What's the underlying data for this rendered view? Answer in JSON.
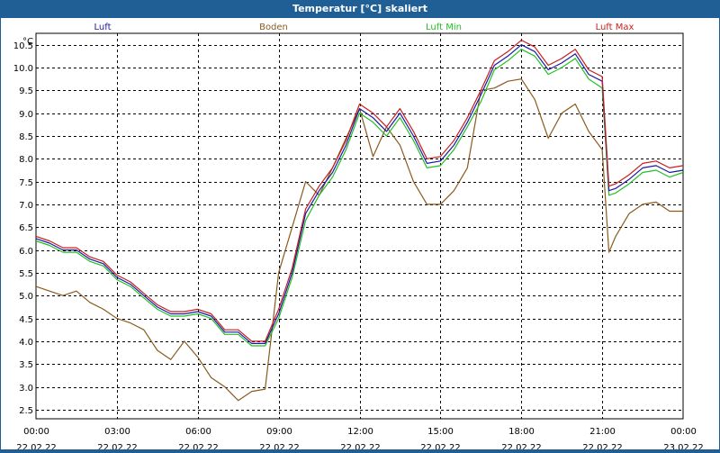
{
  "chart_data": {
    "type": "line",
    "title": "Temperatur [°C] skaliert",
    "ylabel": "°C",
    "ylim": [
      2.3,
      10.75
    ],
    "yticks": [
      2.5,
      3.0,
      3.5,
      4.0,
      4.5,
      5.0,
      5.5,
      6.0,
      6.5,
      7.0,
      7.5,
      8.0,
      8.5,
      9.0,
      9.5,
      10.0,
      10.5
    ],
    "ytick_labels": [
      "2.5",
      "3.0",
      "3.5",
      "4.0",
      "4.5",
      "5.0",
      "5.5",
      "6.0",
      "6.5",
      "7.0",
      "7.5",
      "8.0",
      "8.5",
      "9.0",
      "9.5",
      "10.0",
      "10.5"
    ],
    "x_hours": [
      0,
      3,
      6,
      9,
      12,
      15,
      18,
      21,
      24
    ],
    "xtick_time": [
      "00:00",
      "03:00",
      "06:00",
      "09:00",
      "12:00",
      "15:00",
      "18:00",
      "21:00",
      "00:00"
    ],
    "xtick_date": [
      "22.02.22",
      "22.02.22",
      "22.02.22",
      "22.02.22",
      "22.02.22",
      "22.02.22",
      "22.02.22",
      "22.02.22",
      "23.02.22"
    ],
    "grid": true,
    "legend_position": "top",
    "series": [
      {
        "name": "Luft",
        "color": "#1a1aa6",
        "points": [
          [
            0,
            6.25
          ],
          [
            0.5,
            6.15
          ],
          [
            1,
            6.0
          ],
          [
            1.5,
            6.0
          ],
          [
            2,
            5.8
          ],
          [
            2.5,
            5.7
          ],
          [
            3,
            5.4
          ],
          [
            3.5,
            5.25
          ],
          [
            4,
            5.0
          ],
          [
            4.5,
            4.75
          ],
          [
            5,
            4.6
          ],
          [
            5.5,
            4.6
          ],
          [
            6,
            4.65
          ],
          [
            6.5,
            4.55
          ],
          [
            7,
            4.2
          ],
          [
            7.5,
            4.2
          ],
          [
            8,
            3.95
          ],
          [
            8.5,
            3.95
          ],
          [
            9,
            4.6
          ],
          [
            9.5,
            5.5
          ],
          [
            10,
            6.8
          ],
          [
            10.5,
            7.3
          ],
          [
            11,
            7.7
          ],
          [
            11.5,
            8.3
          ],
          [
            12,
            9.1
          ],
          [
            12.5,
            8.9
          ],
          [
            13,
            8.6
          ],
          [
            13.5,
            9.0
          ],
          [
            14,
            8.5
          ],
          [
            14.5,
            7.9
          ],
          [
            15,
            7.95
          ],
          [
            15.5,
            8.3
          ],
          [
            16,
            8.8
          ],
          [
            16.5,
            9.4
          ],
          [
            17,
            10.05
          ],
          [
            17.5,
            10.25
          ],
          [
            18,
            10.5
          ],
          [
            18.5,
            10.35
          ],
          [
            19,
            9.95
          ],
          [
            19.5,
            10.1
          ],
          [
            20,
            10.3
          ],
          [
            20.5,
            9.85
          ],
          [
            21,
            9.7
          ],
          [
            21.25,
            7.3
          ],
          [
            21.5,
            7.35
          ],
          [
            22,
            7.55
          ],
          [
            22.5,
            7.8
          ],
          [
            23,
            7.85
          ],
          [
            23.5,
            7.7
          ],
          [
            24,
            7.75
          ]
        ]
      },
      {
        "name": "Boden",
        "color": "#8b5a1e",
        "points": [
          [
            0,
            5.2
          ],
          [
            0.5,
            5.1
          ],
          [
            1,
            5.0
          ],
          [
            1.5,
            5.1
          ],
          [
            2,
            4.85
          ],
          [
            2.5,
            4.7
          ],
          [
            3,
            4.5
          ],
          [
            3.5,
            4.4
          ],
          [
            4,
            4.25
          ],
          [
            4.5,
            3.8
          ],
          [
            5,
            3.6
          ],
          [
            5.5,
            4.0
          ],
          [
            6,
            3.65
          ],
          [
            6.5,
            3.2
          ],
          [
            7,
            3.0
          ],
          [
            7.5,
            2.7
          ],
          [
            8,
            2.9
          ],
          [
            8.5,
            2.95
          ],
          [
            9,
            5.5
          ],
          [
            9.5,
            6.5
          ],
          [
            10,
            7.5
          ],
          [
            10.5,
            7.2
          ],
          [
            11,
            7.8
          ],
          [
            11.5,
            8.45
          ],
          [
            12,
            9.1
          ],
          [
            12.5,
            8.05
          ],
          [
            13,
            8.7
          ],
          [
            13.5,
            8.3
          ],
          [
            14,
            7.5
          ],
          [
            14.5,
            7.0
          ],
          [
            15,
            7.0
          ],
          [
            15.5,
            7.3
          ],
          [
            16,
            7.8
          ],
          [
            16.5,
            9.5
          ],
          [
            17,
            9.55
          ],
          [
            17.5,
            9.7
          ],
          [
            18,
            9.75
          ],
          [
            18.5,
            9.3
          ],
          [
            19,
            8.45
          ],
          [
            19.5,
            9.0
          ],
          [
            20,
            9.2
          ],
          [
            20.5,
            8.6
          ],
          [
            21,
            8.2
          ],
          [
            21.25,
            5.95
          ],
          [
            21.5,
            6.3
          ],
          [
            22,
            6.8
          ],
          [
            22.5,
            7.0
          ],
          [
            23,
            7.05
          ],
          [
            23.5,
            6.85
          ],
          [
            24,
            6.85
          ]
        ]
      },
      {
        "name": "Luft Min",
        "color": "#22c022",
        "points": [
          [
            0,
            6.2
          ],
          [
            0.5,
            6.1
          ],
          [
            1,
            5.95
          ],
          [
            1.5,
            5.95
          ],
          [
            2,
            5.75
          ],
          [
            2.5,
            5.65
          ],
          [
            3,
            5.35
          ],
          [
            3.5,
            5.2
          ],
          [
            4,
            4.95
          ],
          [
            4.5,
            4.7
          ],
          [
            5,
            4.55
          ],
          [
            5.5,
            4.55
          ],
          [
            6,
            4.6
          ],
          [
            6.5,
            4.5
          ],
          [
            7,
            4.15
          ],
          [
            7.5,
            4.15
          ],
          [
            8,
            3.9
          ],
          [
            8.5,
            3.9
          ],
          [
            9,
            4.5
          ],
          [
            9.5,
            5.4
          ],
          [
            10,
            6.65
          ],
          [
            10.5,
            7.2
          ],
          [
            11,
            7.6
          ],
          [
            11.5,
            8.2
          ],
          [
            12,
            9.0
          ],
          [
            12.5,
            8.8
          ],
          [
            13,
            8.5
          ],
          [
            13.5,
            8.9
          ],
          [
            14,
            8.4
          ],
          [
            14.5,
            7.8
          ],
          [
            15,
            7.85
          ],
          [
            15.5,
            8.2
          ],
          [
            16,
            8.7
          ],
          [
            16.5,
            9.25
          ],
          [
            17,
            9.95
          ],
          [
            17.5,
            10.15
          ],
          [
            18,
            10.4
          ],
          [
            18.5,
            10.25
          ],
          [
            19,
            9.85
          ],
          [
            19.5,
            10.0
          ],
          [
            20,
            10.2
          ],
          [
            20.5,
            9.75
          ],
          [
            21,
            9.55
          ],
          [
            21.25,
            7.2
          ],
          [
            21.5,
            7.25
          ],
          [
            22,
            7.45
          ],
          [
            22.5,
            7.7
          ],
          [
            23,
            7.75
          ],
          [
            23.5,
            7.6
          ],
          [
            24,
            7.7
          ]
        ]
      },
      {
        "name": "Luft Max",
        "color": "#c81e1e",
        "points": [
          [
            0,
            6.3
          ],
          [
            0.5,
            6.2
          ],
          [
            1,
            6.05
          ],
          [
            1.5,
            6.05
          ],
          [
            2,
            5.85
          ],
          [
            2.5,
            5.75
          ],
          [
            3,
            5.45
          ],
          [
            3.5,
            5.3
          ],
          [
            4,
            5.05
          ],
          [
            4.5,
            4.8
          ],
          [
            5,
            4.65
          ],
          [
            5.5,
            4.65
          ],
          [
            6,
            4.7
          ],
          [
            6.5,
            4.6
          ],
          [
            7,
            4.25
          ],
          [
            7.5,
            4.25
          ],
          [
            8,
            4.0
          ],
          [
            8.5,
            4.0
          ],
          [
            9,
            4.7
          ],
          [
            9.5,
            5.6
          ],
          [
            10,
            6.9
          ],
          [
            10.5,
            7.4
          ],
          [
            11,
            7.8
          ],
          [
            11.5,
            8.4
          ],
          [
            12,
            9.2
          ],
          [
            12.5,
            9.0
          ],
          [
            13,
            8.7
          ],
          [
            13.5,
            9.1
          ],
          [
            14,
            8.6
          ],
          [
            14.5,
            8.0
          ],
          [
            15,
            8.05
          ],
          [
            15.5,
            8.4
          ],
          [
            16,
            8.9
          ],
          [
            16.5,
            9.5
          ],
          [
            17,
            10.15
          ],
          [
            17.5,
            10.35
          ],
          [
            18,
            10.6
          ],
          [
            18.5,
            10.45
          ],
          [
            19,
            10.05
          ],
          [
            19.5,
            10.2
          ],
          [
            20,
            10.4
          ],
          [
            20.5,
            9.95
          ],
          [
            21,
            9.8
          ],
          [
            21.25,
            7.4
          ],
          [
            21.5,
            7.45
          ],
          [
            22,
            7.65
          ],
          [
            22.5,
            7.9
          ],
          [
            23,
            7.95
          ],
          [
            23.5,
            7.8
          ],
          [
            24,
            7.85
          ]
        ]
      }
    ]
  }
}
